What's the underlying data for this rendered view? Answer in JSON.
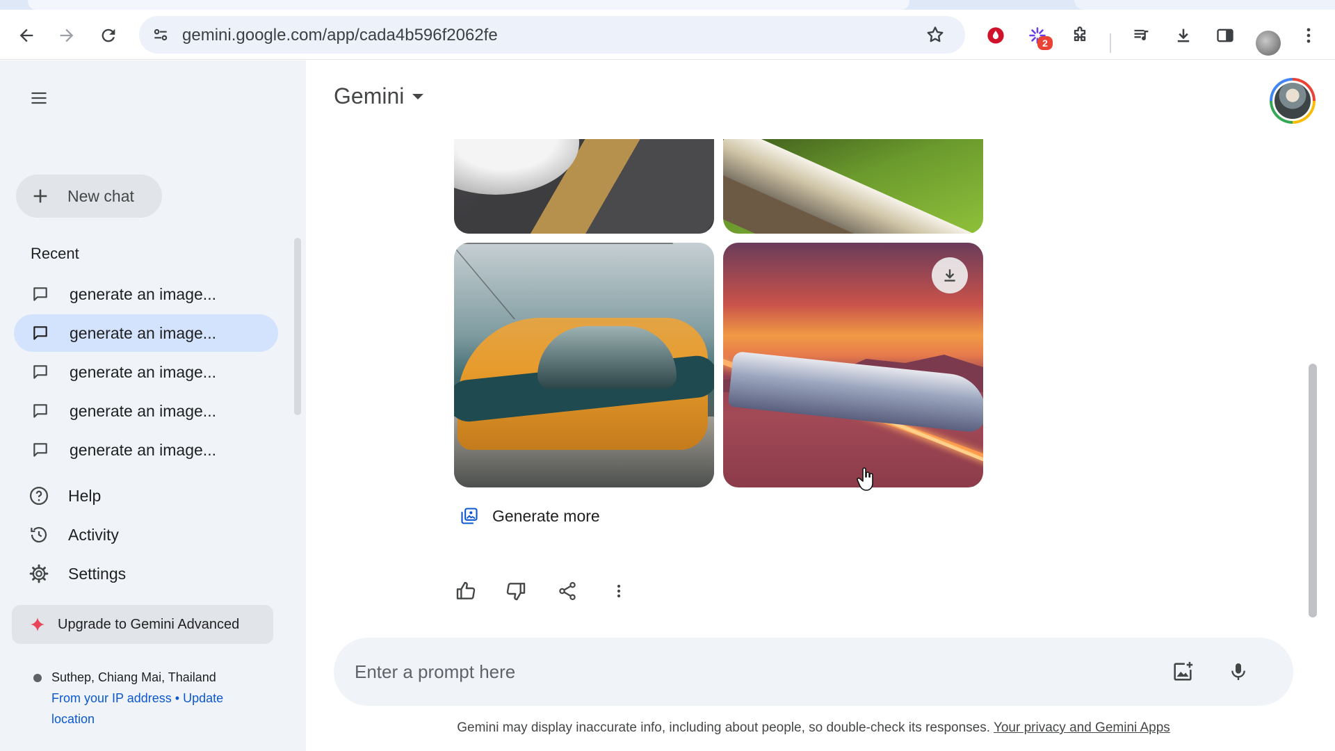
{
  "browser": {
    "url": "gemini.google.com/app/cada4b596f2062fe",
    "extension_badge": "2"
  },
  "sidebar": {
    "new_chat_label": "New chat",
    "recent_title": "Recent",
    "recent_items": [
      {
        "label": "generate an image..."
      },
      {
        "label": "generate an image..."
      },
      {
        "label": "generate an image..."
      },
      {
        "label": "generate an image..."
      },
      {
        "label": "generate an image..."
      }
    ],
    "nav": {
      "help": "Help",
      "activity": "Activity",
      "settings": "Settings"
    },
    "upgrade_label": "Upgrade to Gemini Advanced",
    "location": {
      "place": "Suthep, Chiang Mai, Thailand",
      "from_ip": "From your IP address",
      "separator": "•",
      "update": "Update location"
    }
  },
  "main": {
    "model_name": "Gemini",
    "generate_more_label": "Generate more",
    "prompt_placeholder": "Enter a prompt here",
    "disclaimer_text": "Gemini may display inaccurate info, including about people, so double-check its responses. ",
    "disclaimer_link": "Your privacy and Gemini Apps"
  },
  "icons": {
    "back": "arrow-left-icon",
    "forward": "arrow-right-icon",
    "reload": "reload-icon",
    "star": "star-icon",
    "menu": "hamburger-menu-icon",
    "chat": "chat-bubble-icon",
    "help": "help-circle-icon",
    "activity": "history-icon",
    "settings": "gear-icon",
    "upgrade": "sparkle-icon",
    "download": "download-icon",
    "thumb_up": "thumb-up-icon",
    "thumb_down": "thumb-down-icon",
    "share": "share-icon",
    "more": "more-vertical-icon",
    "image_upload": "add-image-icon",
    "mic": "microphone-icon"
  },
  "colors": {
    "sidebar_bg": "#f0f4f9",
    "active_item": "#d3e3fd",
    "link": "#0b57d0",
    "upgrade_sparkle": "#e8455a"
  }
}
